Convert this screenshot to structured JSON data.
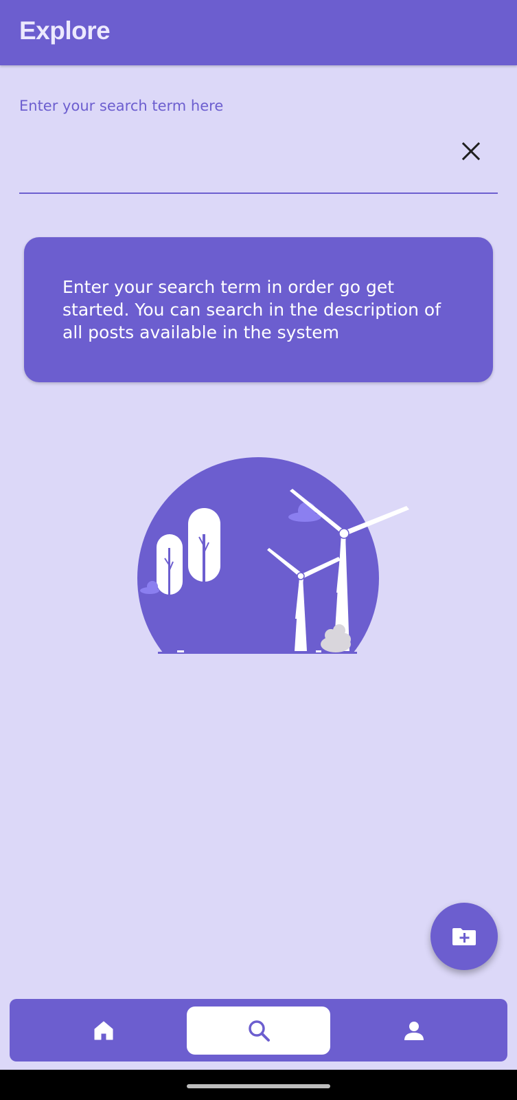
{
  "app_bar": {
    "title": "Explore",
    "background": "#6c5ecf"
  },
  "search": {
    "label": "Enter your search term here",
    "value": "",
    "clear_icon": "close-icon"
  },
  "info_card": {
    "text": "Enter your search term in order go get started. You can search in the description of all posts available in the system"
  },
  "illustration": {
    "icon": "wind-turbines-illustration"
  },
  "fab": {
    "icon": "folder-plus-icon"
  },
  "bottom_nav": {
    "items": [
      {
        "id": "home",
        "icon": "home-icon",
        "active": false
      },
      {
        "id": "search",
        "icon": "search-icon",
        "active": true
      },
      {
        "id": "profile",
        "icon": "person-icon",
        "active": false
      }
    ]
  },
  "colors": {
    "primary": "#6c5ecf",
    "background": "#dcd8f8",
    "on_primary": "#ffffff"
  }
}
